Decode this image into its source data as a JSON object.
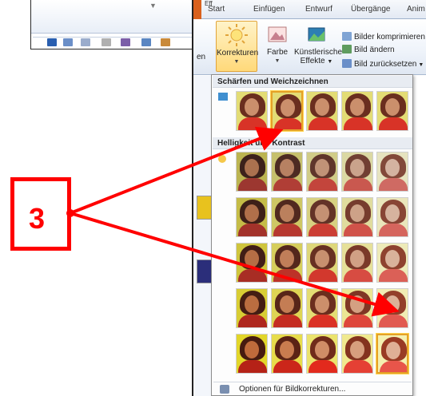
{
  "ribbon_tabs": [
    "Start",
    "Einfügen",
    "Entwurf",
    "Übergänge",
    "Anim"
  ],
  "partial_tab_text": "Eff",
  "ribbon_left_fragment": "en",
  "buttons": {
    "corrections": "Korrekturen",
    "color": "Farbe",
    "artistic_line1": "Künstlerische",
    "artistic_line2": "Effekte"
  },
  "small_buttons": {
    "compress": "Bilder komprimieren",
    "change": "Bild ändern",
    "reset": "Bild zurücksetzen"
  },
  "panel": {
    "section_sharpen": "Schärfen und Weichzeichnen",
    "section_brightness": "Helligkeit und Kontrast",
    "options_footer": "Optionen für Bildkorrekturen..."
  },
  "overlay": {
    "step_number": "3",
    "color": "#ff0000"
  },
  "thumbnail_grid": {
    "sharpen_row_count": 5,
    "brightness_rows": 5,
    "brightness_cols": 5,
    "selected_sharpen_index": 1,
    "selected_brightness_cell": [
      4,
      4
    ]
  }
}
